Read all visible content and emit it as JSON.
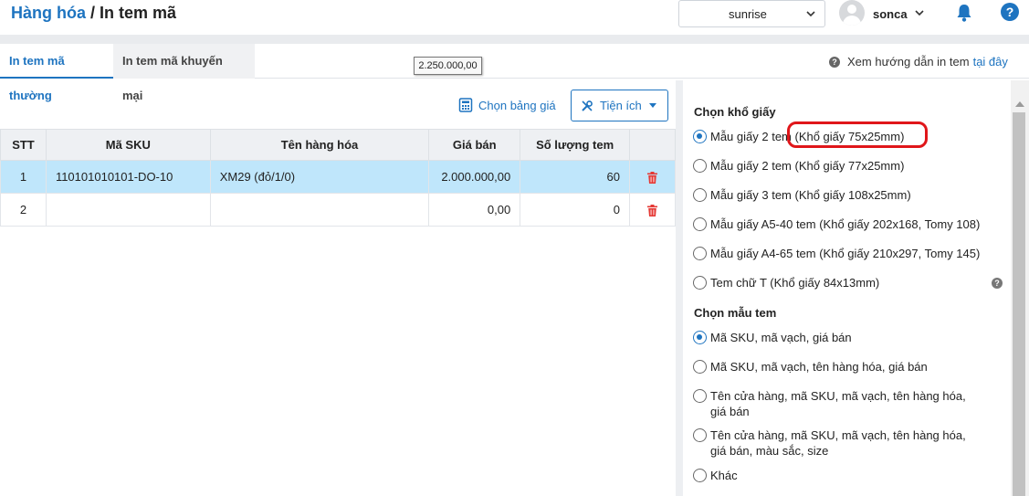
{
  "header": {
    "breadcrumb": "Hàng hóa",
    "separator": " / ",
    "title": "In tem mã",
    "store_select_value": "sunrise",
    "user_name": "sonca"
  },
  "tabs": [
    {
      "label": "In tem mã thường",
      "active": true
    },
    {
      "label": "In tem mã khuyến mại",
      "active": false
    }
  ],
  "tooltip": "2.250.000,00",
  "guide": {
    "text": "Xem hướng dẫn in tem",
    "link": "tại đây"
  },
  "toolbar": {
    "price_table_label": "Chọn bảng giá",
    "utilities_label": "Tiện ích"
  },
  "table": {
    "headers": [
      "STT",
      "Mã SKU",
      "Tên hàng hóa",
      "Giá bán",
      "Số lượng tem",
      ""
    ],
    "rows": [
      {
        "stt": "1",
        "sku": "110101010101-DO-10",
        "name": "XM29 (đỏ/1/0)",
        "price": "2.000.000,00",
        "qty": "60",
        "selected": true
      },
      {
        "stt": "2",
        "sku": "",
        "name": "",
        "price": "0,00",
        "qty": "0",
        "selected": false
      }
    ]
  },
  "paper": {
    "section_label": "Chọn khổ giấy",
    "options": [
      {
        "label": "Mẫu giấy 2 tem (Khổ giấy 75x25mm)",
        "selected": true
      },
      {
        "label": "Mẫu giấy 2 tem (Khổ giấy 77x25mm)",
        "selected": false
      },
      {
        "label": "Mẫu giấy 3 tem (Khổ giấy 108x25mm)",
        "selected": false
      },
      {
        "label": "Mẫu giấy A5-40 tem (Khổ giấy 202x168, Tomy 108)",
        "selected": false
      },
      {
        "label": "Mẫu giấy A4-65 tem (Khổ giấy 210x297, Tomy 145)",
        "selected": false
      },
      {
        "label": "Tem chữ T (Khổ giấy 84x13mm)",
        "selected": false
      }
    ]
  },
  "template": {
    "section_label": "Chọn mẫu tem",
    "options": [
      {
        "label": "Mã SKU, mã vạch, giá bán",
        "selected": true
      },
      {
        "label": "Mã SKU, mã vạch, tên hàng hóa, giá bán",
        "selected": false
      },
      {
        "label": "Tên cửa hàng, mã SKU, mã vạch, tên hàng hóa, giá bán",
        "selected": false
      },
      {
        "label": "Tên cửa hàng, mã SKU, mã vạch, tên hàng hóa, giá bán, màu sắc, size",
        "selected": false
      },
      {
        "label": "Khác",
        "selected": false
      }
    ]
  },
  "colors": {
    "accent": "#1e74c0",
    "selected_row": "#bfe6fb",
    "highlight": "#e0161a",
    "delete": "#e53935"
  }
}
